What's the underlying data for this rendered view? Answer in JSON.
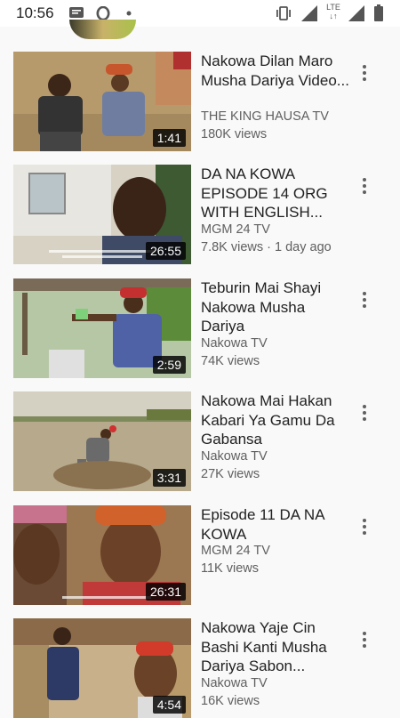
{
  "status_bar": {
    "time": "10:56",
    "network_label": "LTE",
    "icons": [
      "message-icon",
      "opera-icon",
      "dot-icon",
      "vibrate-icon",
      "signal-icon",
      "lte-icon",
      "signal-icon",
      "battery-icon"
    ]
  },
  "videos": [
    {
      "title": "Nakowa Dilan Maro Musha Dariya Video...",
      "channel": "THE KING HAUSA TV",
      "views": "180K views",
      "duration": "1:41"
    },
    {
      "title": "DA NA KOWA EPISODE 14 ORG WITH ENGLISH...",
      "channel": "MGM 24 TV",
      "views": "7.8K views · 1 day ago",
      "duration": "26:55"
    },
    {
      "title": "Teburin Mai Shayi Nakowa Musha Dariya",
      "channel": "Nakowa TV",
      "views": "74K views",
      "duration": "2:59"
    },
    {
      "title": "Nakowa Mai Hakan Kabari Ya Gamu Da Gabansa",
      "channel": "Nakowa TV",
      "views": "27K views",
      "duration": "3:31"
    },
    {
      "title": "Episode 11 DA NA KOWA",
      "channel": "MGM 24 TV",
      "views": "11K views",
      "duration": "26:31"
    },
    {
      "title": "Nakowa Yaje Cin Bashi Kanti Musha Dariya Sabon...",
      "channel": "Nakowa TV",
      "views": "16K views",
      "duration": "4:54"
    }
  ]
}
